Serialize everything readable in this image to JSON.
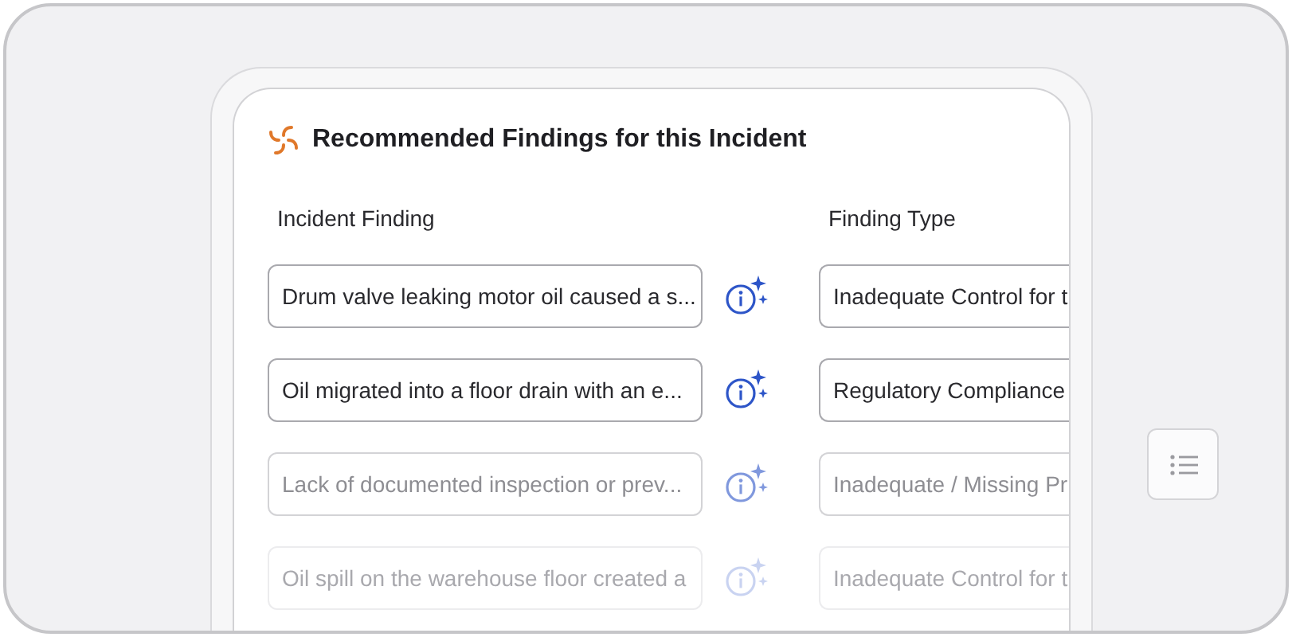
{
  "panel": {
    "title": "Recommended Findings for this Incident"
  },
  "columns": [
    "Incident Finding",
    "Finding Type"
  ],
  "rows": [
    {
      "finding": "Drum valve leaking motor oil caused a s...",
      "type": "Inadequate Control for t"
    },
    {
      "finding": "Oil migrated into a floor drain with an e...",
      "type": "Regulatory Compliance"
    },
    {
      "finding": "Lack of documented inspection or prev...",
      "type": "Inadequate / Missing Pr"
    },
    {
      "finding": "Oil spill on the warehouse floor created a",
      "type": "Inadequate Control for t"
    }
  ]
}
